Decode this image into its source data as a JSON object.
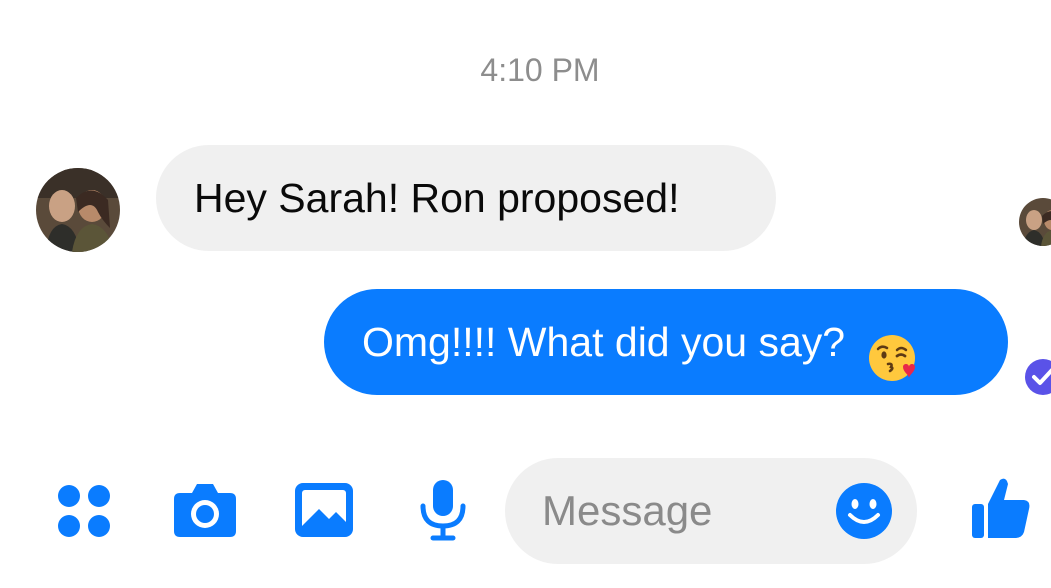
{
  "timestamp": "4:10 PM",
  "messages": [
    {
      "direction": "incoming",
      "text": "Hey Sarah! Ron proposed!"
    },
    {
      "direction": "outgoing",
      "text": "Omg!!!! What did you say?",
      "emoji": "kissing-face-with-heart-emoji"
    }
  ],
  "composer": {
    "placeholder": "Message",
    "icons": [
      "more-apps-icon",
      "camera-icon",
      "gallery-icon",
      "microphone-icon",
      "emoji-icon",
      "thumbs-up-icon"
    ]
  },
  "colors": {
    "accent": "#0a7cff",
    "incoming_bubble": "#f0f0f0",
    "status_check": "#5a52e8"
  }
}
